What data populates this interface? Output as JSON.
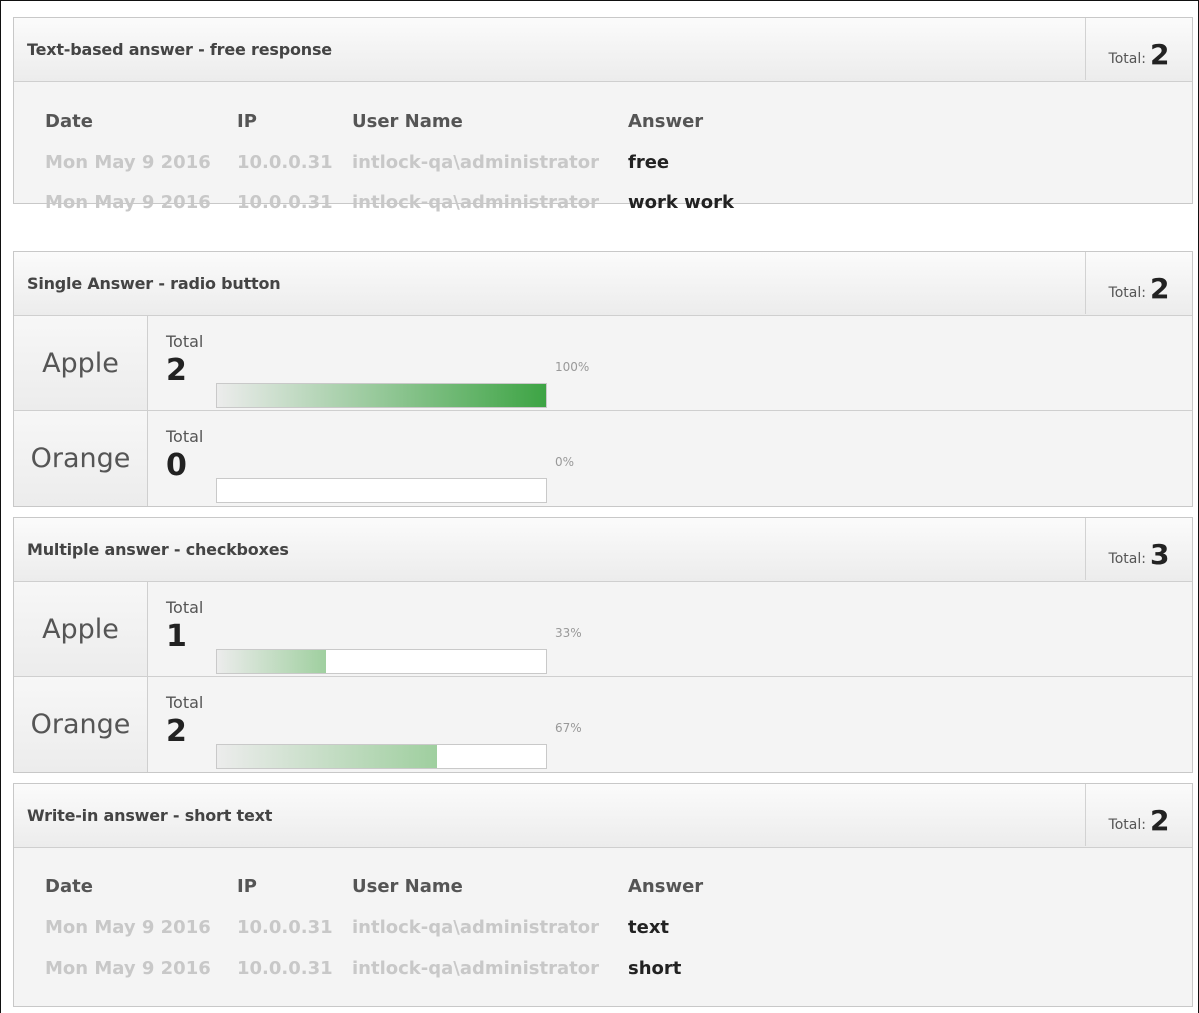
{
  "columns": {
    "date": "Date",
    "ip": "IP",
    "user": "User Name",
    "answer": "Answer"
  },
  "total_label": "Total:",
  "option_total_label": "Total",
  "colors": {
    "bar_full": "#3da444",
    "bar_light": "#9fcf9f"
  },
  "panels": [
    {
      "title": "Text-based answer - free response",
      "total": "2",
      "rows": [
        {
          "date": "Mon May 9 2016",
          "ip": "10.0.0.31",
          "user": "intlock-qa\\administrator",
          "answer": "free"
        },
        {
          "date": "Mon May 9 2016",
          "ip": "10.0.0.31",
          "user": "intlock-qa\\administrator",
          "answer": "work work"
        }
      ]
    },
    {
      "title": "Single Answer - radio button",
      "total": "2",
      "options": [
        {
          "label": "Apple",
          "count": "2",
          "percent": "100%",
          "fraction": 1.0
        },
        {
          "label": "Orange",
          "count": "0",
          "percent": "0%",
          "fraction": 0.0
        }
      ]
    },
    {
      "title": "Multiple answer - checkboxes",
      "total": "3",
      "options": [
        {
          "label": "Apple",
          "count": "1",
          "percent": "33%",
          "fraction": 0.33
        },
        {
          "label": "Orange",
          "count": "2",
          "percent": "67%",
          "fraction": 0.67
        }
      ]
    },
    {
      "title": "Write-in answer - short text",
      "total": "2",
      "rows": [
        {
          "date": "Mon May 9 2016",
          "ip": "10.0.0.31",
          "user": "intlock-qa\\administrator",
          "answer": "text"
        },
        {
          "date": "Mon May 9 2016",
          "ip": "10.0.0.31",
          "user": "intlock-qa\\administrator",
          "answer": "short"
        }
      ]
    }
  ]
}
